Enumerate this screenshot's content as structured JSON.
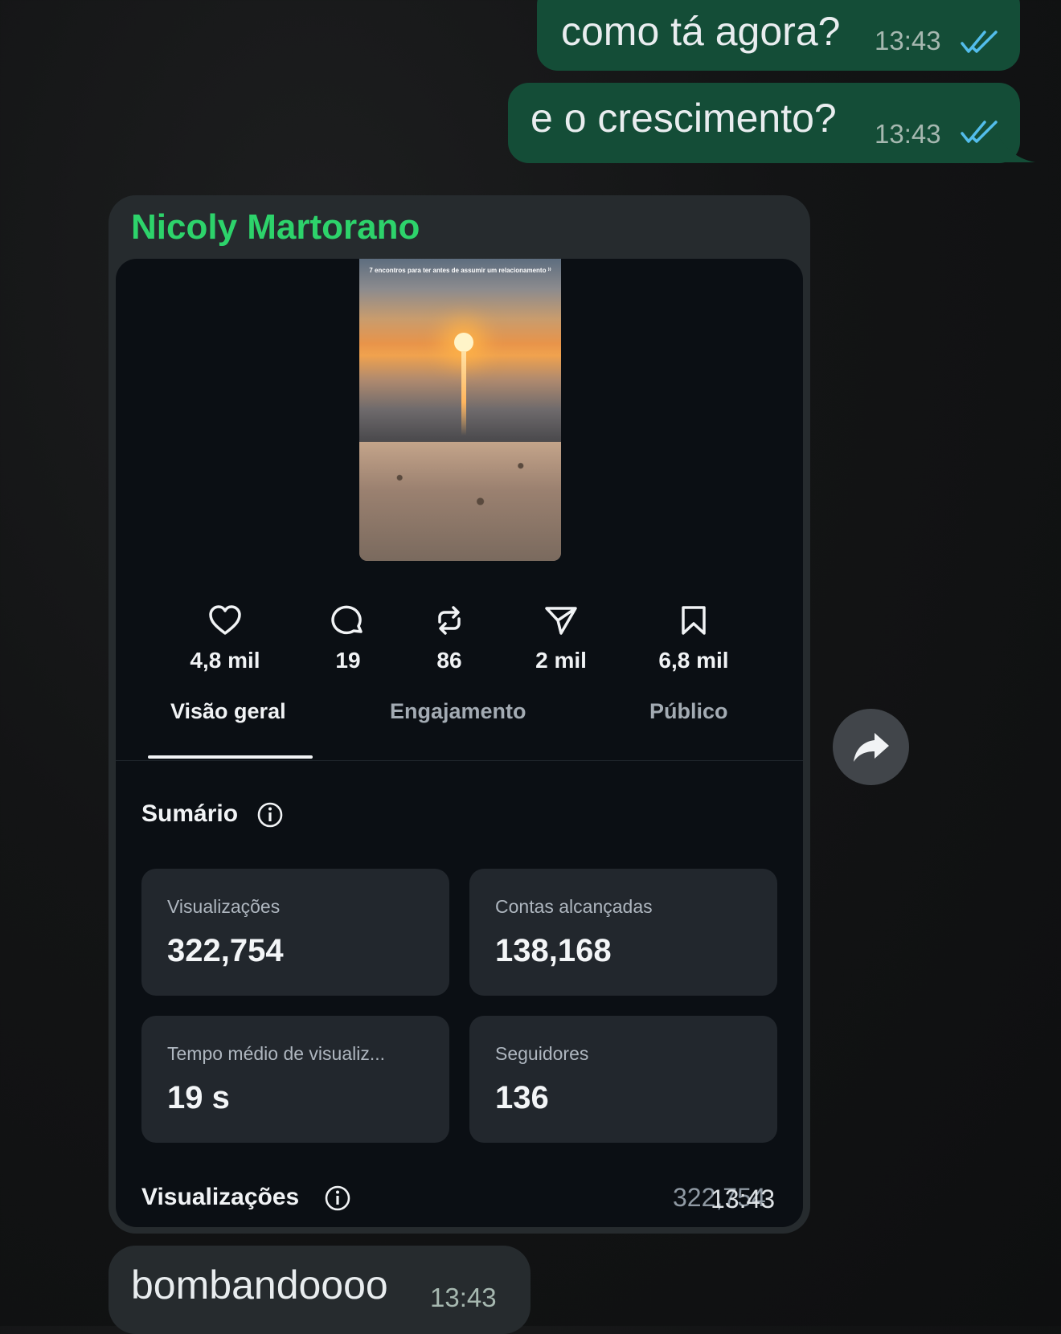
{
  "messages_out": [
    {
      "text": "como tá agora?",
      "time": "13:43"
    },
    {
      "text": "e o crescimento?",
      "time": "13:43"
    }
  ],
  "card": {
    "sender": "Nicoly Martorano",
    "thumbnail_caption": "7 encontros para ter antes de assumir um relacionamento ⁾⁾",
    "stats": [
      {
        "icon": "heart-icon",
        "value": "4,8 mil"
      },
      {
        "icon": "comment-icon",
        "value": "19"
      },
      {
        "icon": "repost-icon",
        "value": "86"
      },
      {
        "icon": "send-icon",
        "value": "2 mil"
      },
      {
        "icon": "bookmark-icon",
        "value": "6,8 mil"
      }
    ],
    "tabs": [
      "Visão geral",
      "Engajamento",
      "Público"
    ],
    "active_tab": "Visão geral",
    "summary_title": "Sumário",
    "metrics": [
      {
        "label": "Visualizações",
        "value": "322,754"
      },
      {
        "label": "Contas alcançadas",
        "value": "138,168"
      },
      {
        "label": "Tempo médio de visualiz...",
        "value": "19 s"
      },
      {
        "label": "Seguidores",
        "value": "136"
      }
    ],
    "views_title": "Visualizações",
    "views_value_partial": "322,754",
    "time": "13:43"
  },
  "message_in": {
    "text": "bombandoooo",
    "time": "13:43"
  },
  "colors": {
    "out_bubble": "#144d37",
    "sender_name": "#2dd36b",
    "read_ticks": "#53bdeb"
  }
}
